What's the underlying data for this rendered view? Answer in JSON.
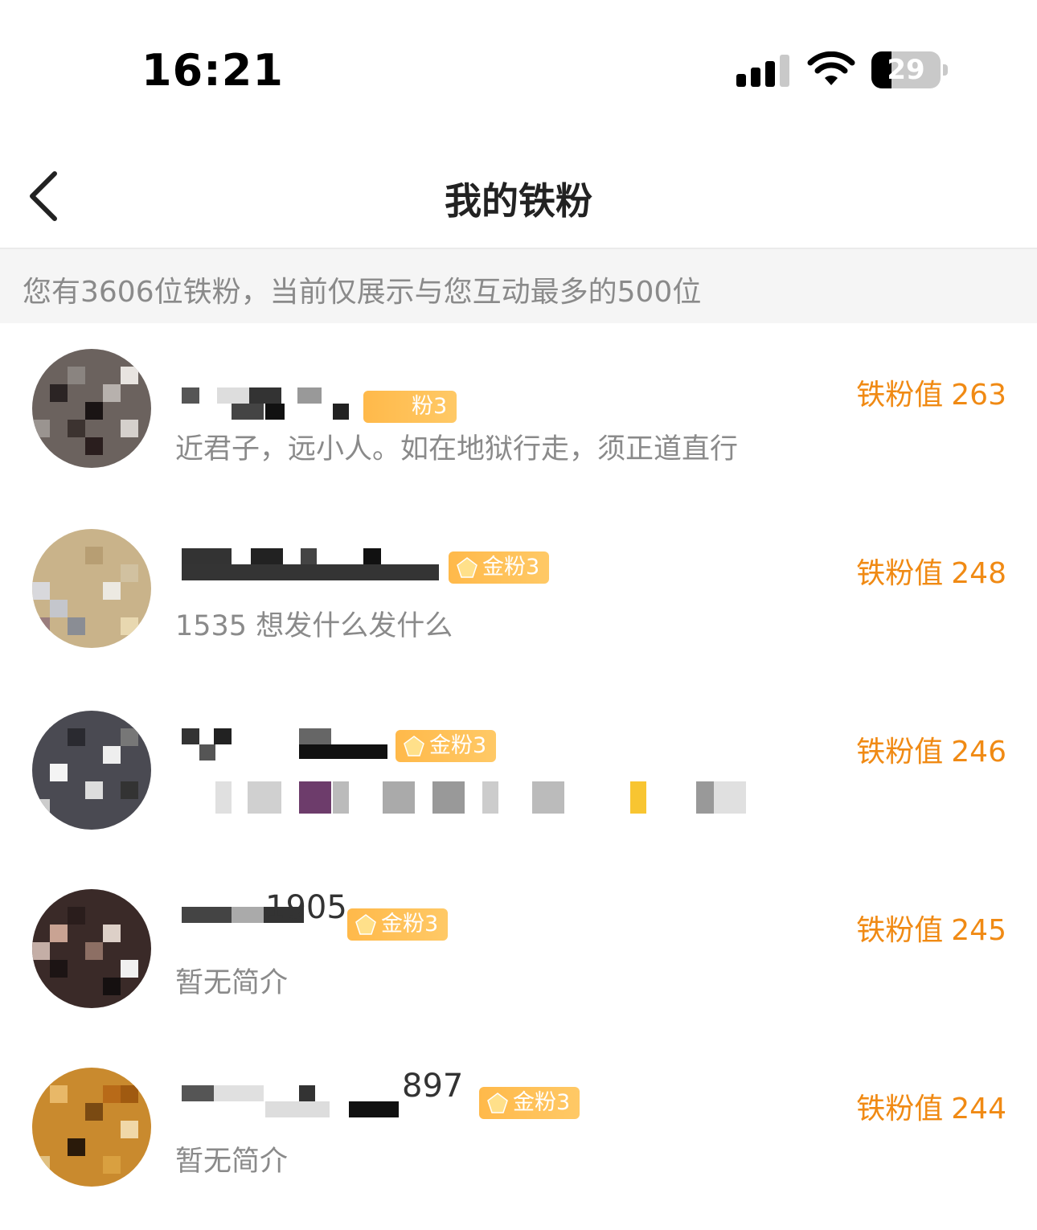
{
  "status_bar": {
    "time": "16:21",
    "battery_level": "29",
    "battery_fraction": 0.29,
    "icons": [
      "signal-icon",
      "wifi-icon",
      "battery-icon"
    ]
  },
  "nav": {
    "title": "我的铁粉",
    "back_icon": "chevron-left-icon"
  },
  "notice": {
    "text": "您有3606位铁粉，当前仅展示与您互动最多的500位"
  },
  "fans": [
    {
      "name_visible": "",
      "badge": "粉3",
      "bio": "近君子，远小人。如在地狱行走，须正道直行",
      "score_label": "铁粉值",
      "score": "263"
    },
    {
      "name_visible": "",
      "badge": "金粉3",
      "bio": "1535 想发什么发什么",
      "score_label": "铁粉值",
      "score": "248"
    },
    {
      "name_visible": "",
      "badge": "金粉3",
      "bio": "",
      "score_label": "铁粉值",
      "score": "246"
    },
    {
      "name_visible": "1905",
      "badge": "金粉3",
      "bio": "暂无简介",
      "score_label": "铁粉值",
      "score": "245"
    },
    {
      "name_visible": "897",
      "badge": "金粉3",
      "bio": "暂无简介",
      "score_label": "铁粉值",
      "score": "244"
    }
  ],
  "colors": {
    "accent": "#f08a14",
    "badge": "#ffb94a",
    "notice_bg": "#f5f5f5",
    "secondary_text": "#8a8a8a"
  }
}
